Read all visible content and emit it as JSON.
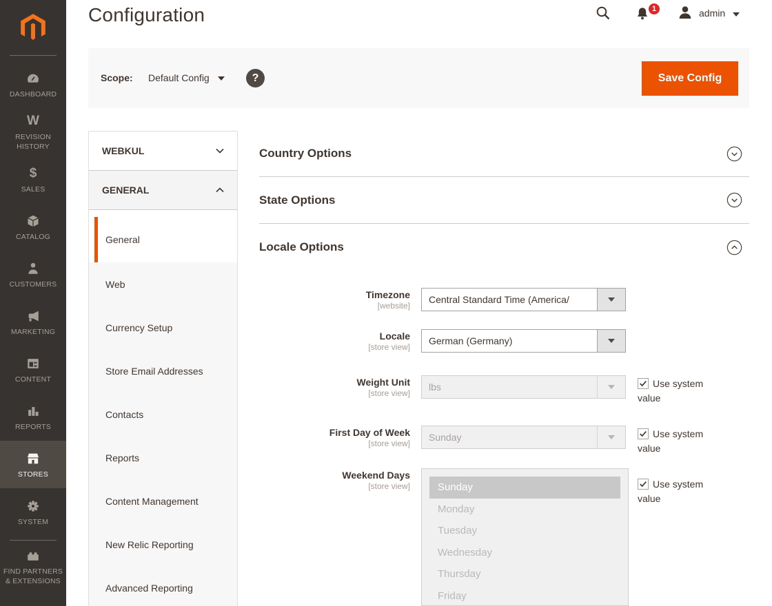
{
  "header": {
    "title": "Configuration",
    "user_name": "admin",
    "notification_count": "1"
  },
  "scope_bar": {
    "label": "Scope:",
    "value": "Default Config",
    "help": "?",
    "save_button": "Save Config"
  },
  "sidebar": {
    "items": [
      {
        "label": "DASHBOARD"
      },
      {
        "label": "REVISION HISTORY"
      },
      {
        "label": "SALES"
      },
      {
        "label": "CATALOG"
      },
      {
        "label": "CUSTOMERS"
      },
      {
        "label": "MARKETING"
      },
      {
        "label": "CONTENT"
      },
      {
        "label": "REPORTS"
      },
      {
        "label": "STORES"
      },
      {
        "label": "SYSTEM"
      },
      {
        "label": "FIND PARTNERS & EXTENSIONS"
      }
    ],
    "active_item": "STORES"
  },
  "config_nav": {
    "group1": "WEBKUL",
    "group2": "GENERAL",
    "items": [
      "General",
      "Web",
      "Currency Setup",
      "Store Email Addresses",
      "Contacts",
      "Reports",
      "Content Management",
      "New Relic Reporting",
      "Advanced Reporting"
    ],
    "active_item": "General"
  },
  "sections": {
    "country": "Country Options",
    "state": "State Options",
    "locale": "Locale Options"
  },
  "form": {
    "timezone": {
      "label": "Timezone",
      "scope": "[website]",
      "value": "Central Standard Time (America/"
    },
    "locale": {
      "label": "Locale",
      "scope": "[store view]",
      "value": "German (Germany)"
    },
    "weight_unit": {
      "label": "Weight Unit",
      "scope": "[store view]",
      "value": "lbs",
      "disabled": true,
      "use_system_label": "Use system value",
      "use_system_checked": true
    },
    "first_day": {
      "label": "First Day of Week",
      "scope": "[store view]",
      "value": "Sunday",
      "disabled": true,
      "use_system_label": "Use system value",
      "use_system_checked": true
    },
    "weekend_days": {
      "label": "Weekend Days",
      "scope": "[store view]",
      "options": [
        "Sunday",
        "Monday",
        "Tuesday",
        "Wednesday",
        "Thursday",
        "Friday"
      ],
      "selected": "Sunday",
      "disabled": true,
      "use_system_label": "Use system value",
      "use_system_checked": true
    }
  },
  "colors": {
    "accent": "#eb5202",
    "sidebar_bg": "#373330",
    "badge_red": "#e22626",
    "active_nav_border": "#eb5202"
  }
}
